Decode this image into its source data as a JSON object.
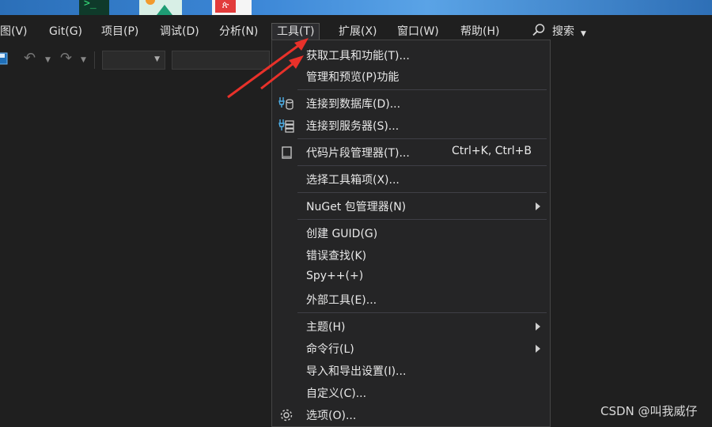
{
  "taskbar": {
    "apps": [
      "terminal-app-icon",
      "photos-app-icon",
      "pdf-app-icon"
    ]
  },
  "menubar": {
    "view": "视图(V)",
    "git": "Git(G)",
    "project": "项目(P)",
    "debug": "调试(D)",
    "analyze": "分析(N)",
    "tools": "工具(T)",
    "extensions": "扩展(X)",
    "window": "窗口(W)",
    "help": "帮助(H)",
    "search": "搜索"
  },
  "toolbar": {
    "combo1": "",
    "combo2": ""
  },
  "tools_menu": {
    "get_tools": "获取工具和功能(T)...",
    "manage_preview": "管理和预览(P)功能",
    "connect_db": "连接到数据库(D)...",
    "connect_server": "连接到服务器(S)...",
    "snippets": "代码片段管理器(T)...",
    "snippets_shortcut": "Ctrl+K, Ctrl+B",
    "toolbox_items": "选择工具箱项(X)...",
    "nuget": "NuGet 包管理器(N)",
    "create_guid": "创建 GUID(G)",
    "error_lookup": "错误查找(K)",
    "spy": "Spy++(+)",
    "external_tools": "外部工具(E)...",
    "theme": "主题(H)",
    "command_line": "命令行(L)",
    "import_export": "导入和导出设置(I)...",
    "customize": "自定义(C)...",
    "options": "选项(O)..."
  },
  "watermark": "CSDN @叫我威仔",
  "colors": {
    "annotation_arrow": "#e8312a",
    "background": "#1f1f1f",
    "menu_bg": "#252526"
  }
}
